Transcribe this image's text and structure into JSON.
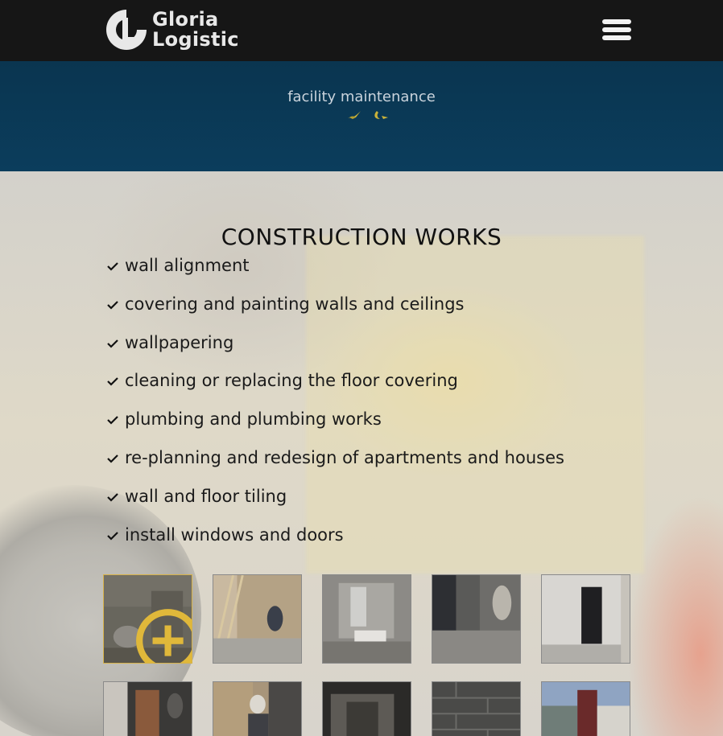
{
  "header": {
    "brand_line1": "Gloria",
    "brand_line2": "Logistic",
    "menu_icon": "hamburger-menu-icon",
    "colors": {
      "bar": "#161616",
      "logo": "#e8e8e8"
    }
  },
  "band": {
    "caption": "facility maintenance",
    "icon": "leaf-icon",
    "colors": {
      "background": "#0b3d5c",
      "icon": "#c9b23a"
    }
  },
  "section": {
    "title": "CONSTRUCTION WORKS",
    "check_icon": "check-icon",
    "items": [
      "wall alignment",
      "covering and painting walls and ceilings",
      "wallpapering",
      "cleaning or replacing the floor covering",
      "plumbing and plumbing works",
      "re-planning and redesign of apartments and houses",
      "wall and floor tiling",
      "install windows and doors"
    ]
  },
  "gallery": {
    "zoom_icon": "zoom-in-icon",
    "active_border_color": "#d6b24a",
    "photos": [
      "photo-worker-drilling-wall",
      "photo-brick-wall-ladder",
      "photo-unfinished-room",
      "photo-floor-demolition",
      "photo-room-doorway",
      "photo-worker-dark-room",
      "photo-worker-mask",
      "photo-corridor",
      "photo-block-wall",
      "photo-building-facade"
    ]
  }
}
